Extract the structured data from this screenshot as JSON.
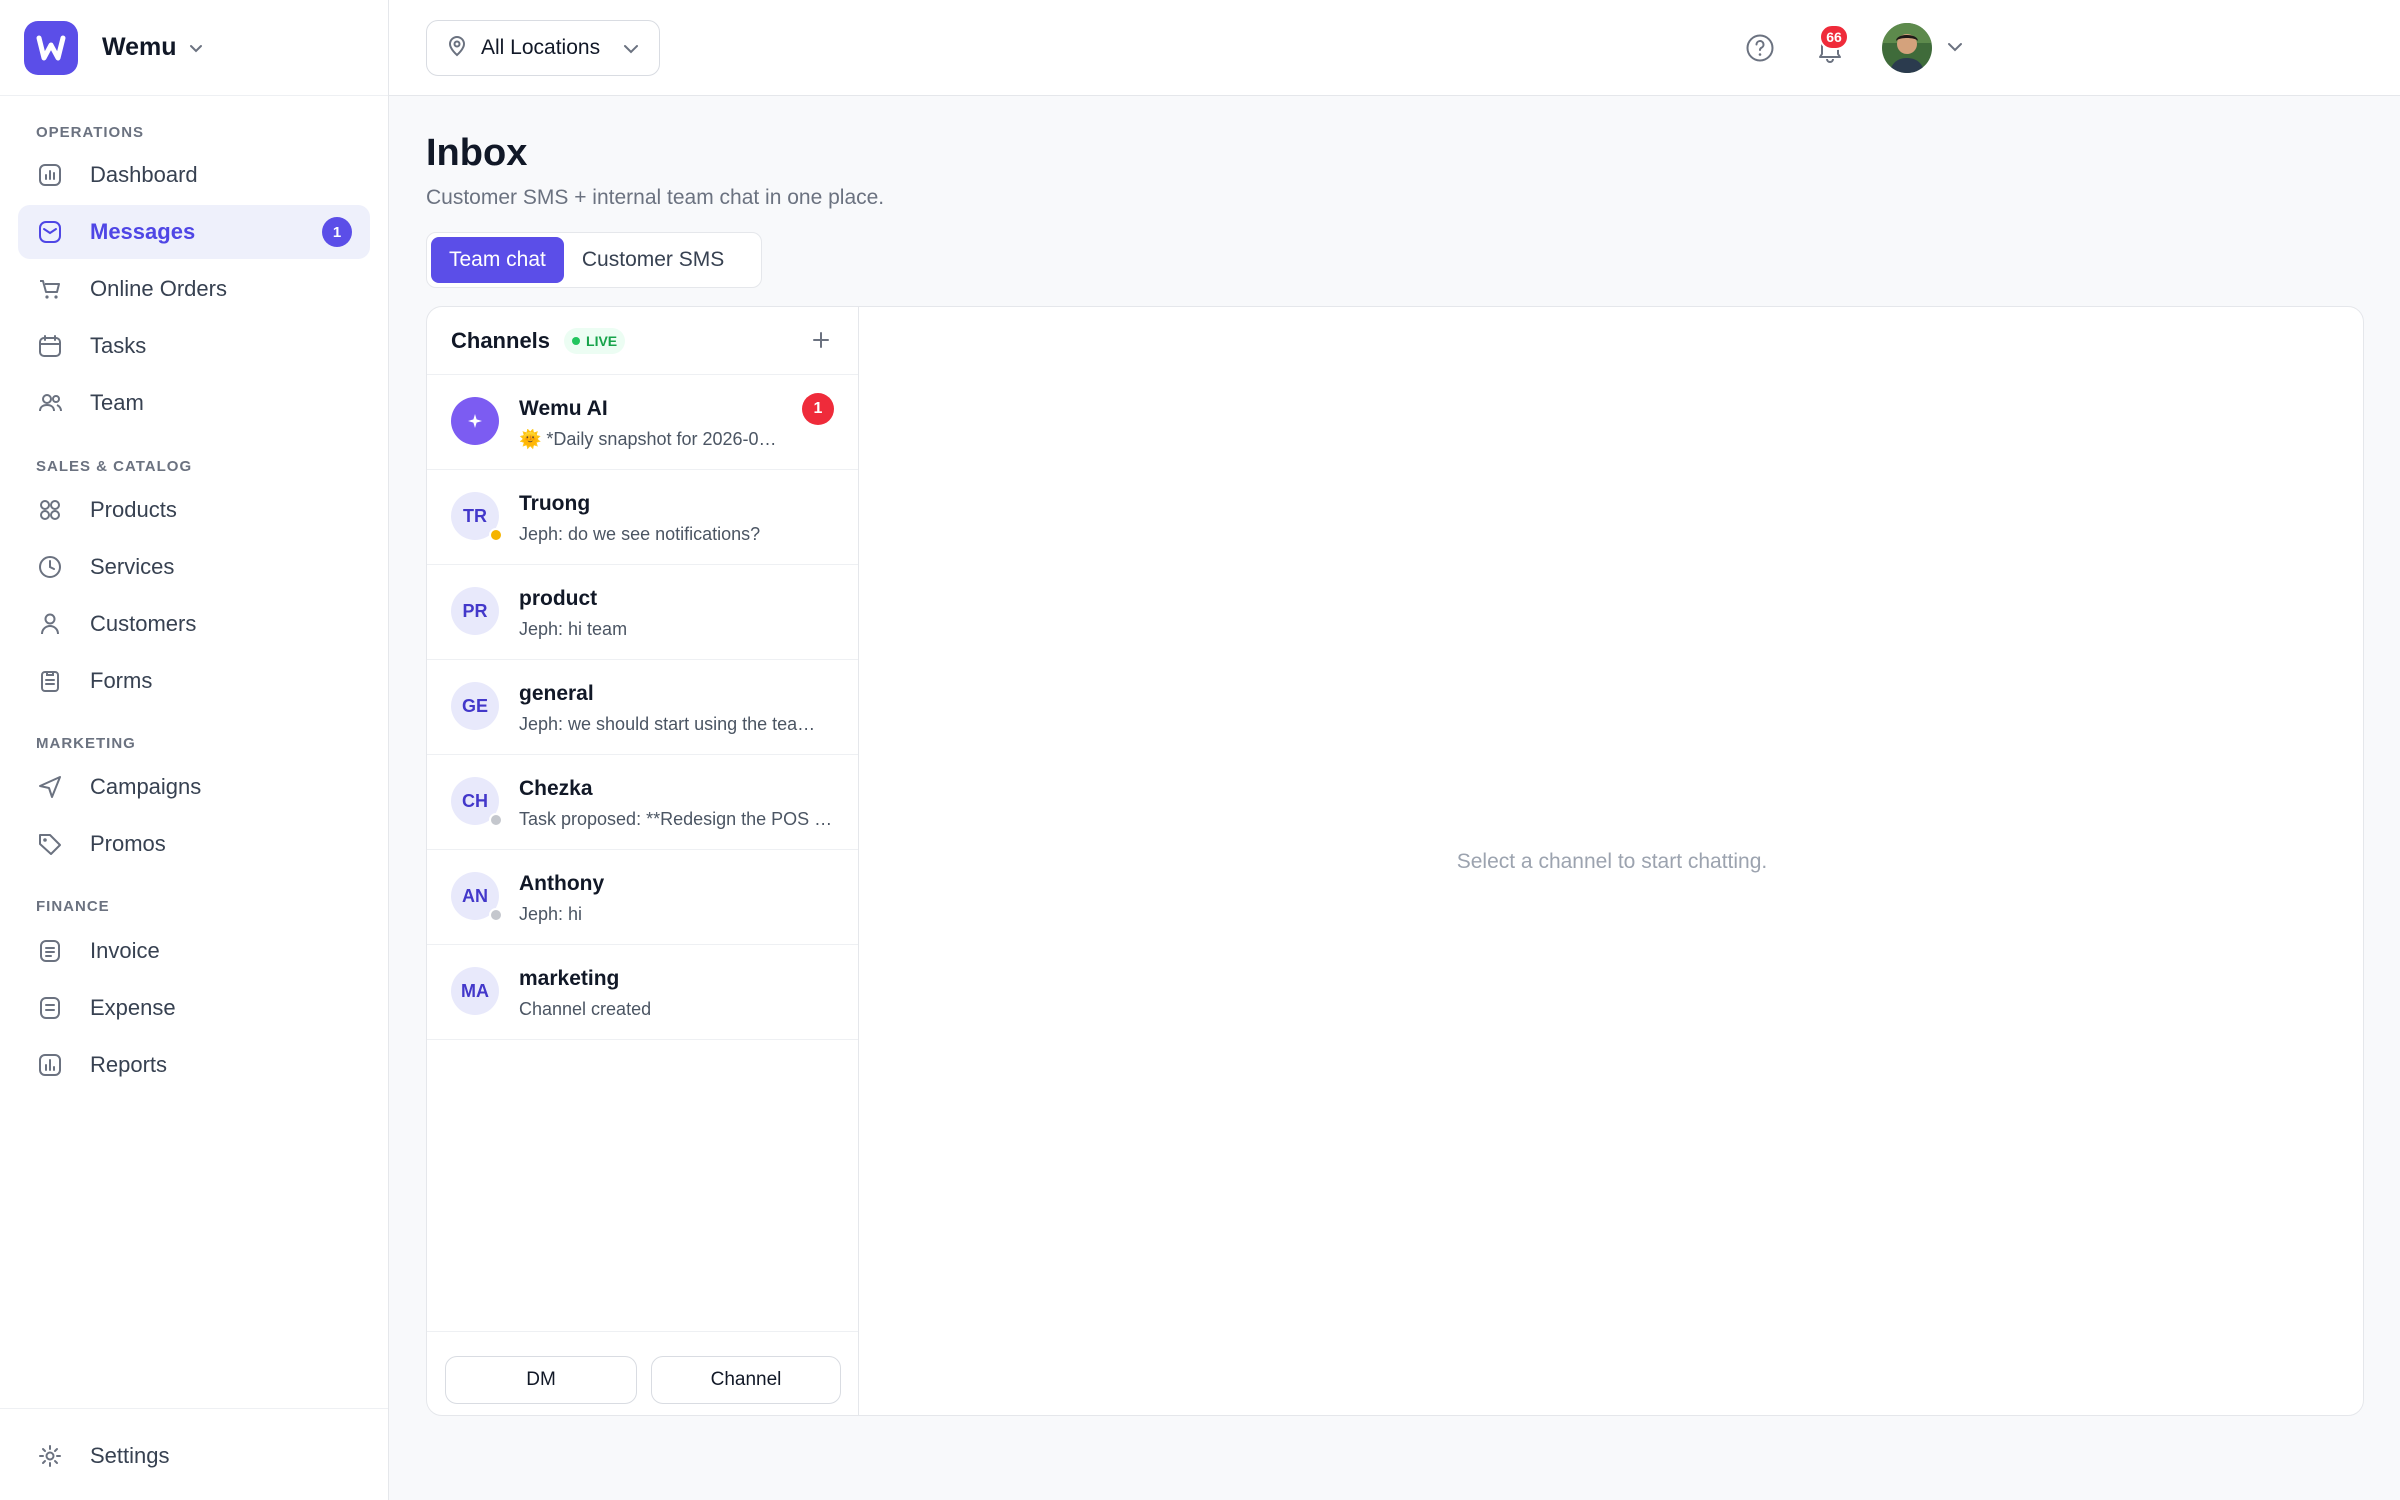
{
  "brand": {
    "name": "Wemu"
  },
  "sidebar": {
    "sections": {
      "operations": "OPERATIONS",
      "sales": "SALES & CATALOG",
      "marketing": "MARKETING",
      "finance": "FINANCE"
    },
    "items": [
      {
        "label": "Dashboard",
        "icon": "chart-icon"
      },
      {
        "label": "Messages",
        "icon": "message-icon",
        "badge": "1",
        "active": true
      },
      {
        "label": "Online Orders",
        "icon": "cart-icon"
      },
      {
        "label": "Tasks",
        "icon": "calendar-icon"
      },
      {
        "label": "Team",
        "icon": "users-icon"
      },
      {
        "label": "Products",
        "icon": "grid-icon"
      },
      {
        "label": "Services",
        "icon": "clock-icon"
      },
      {
        "label": "Customers",
        "icon": "user-icon"
      },
      {
        "label": "Forms",
        "icon": "clipboard-icon"
      },
      {
        "label": "Campaigns",
        "icon": "send-icon"
      },
      {
        "label": "Promos",
        "icon": "tag-icon"
      },
      {
        "label": "Invoice",
        "icon": "document-icon"
      },
      {
        "label": "Expense",
        "icon": "receipt-icon"
      },
      {
        "label": "Reports",
        "icon": "report-icon"
      }
    ],
    "settings": "Settings"
  },
  "topbar": {
    "location": "All Locations",
    "notifications": "66"
  },
  "page": {
    "title": "Inbox",
    "subtitle": "Customer SMS + internal team chat in one place.",
    "tabs": [
      "Team chat",
      "Customer SMS"
    ]
  },
  "channels": {
    "title": "Channels",
    "live": "LIVE",
    "items": [
      {
        "initials": "",
        "name": "Wemu AI",
        "preview": "🌞 *Daily snapshot for 2026-0…",
        "unread": "1"
      },
      {
        "initials": "TR",
        "name": "Truong",
        "preview": "Jeph: do we see notifications?"
      },
      {
        "initials": "PR",
        "name": "product",
        "preview": "Jeph: hi team"
      },
      {
        "initials": "GE",
        "name": "general",
        "preview": "Jeph: we should start using the tea…"
      },
      {
        "initials": "CH",
        "name": "Chezka",
        "preview": "Task proposed: **Redesign the POS …"
      },
      {
        "initials": "AN",
        "name": "Anthony",
        "preview": "Jeph: hi"
      },
      {
        "initials": "MA",
        "name": "marketing",
        "preview": "Channel created"
      }
    ],
    "footer": {
      "dm": "DM",
      "channel": "Channel"
    }
  },
  "empty_state": "Select a channel to start chatting.",
  "colors": {
    "accent": "#5b4ee8",
    "badge_red": "#ef2b3a",
    "presence_away": "#f5b400",
    "presence_offline": "#c4c7cd"
  }
}
